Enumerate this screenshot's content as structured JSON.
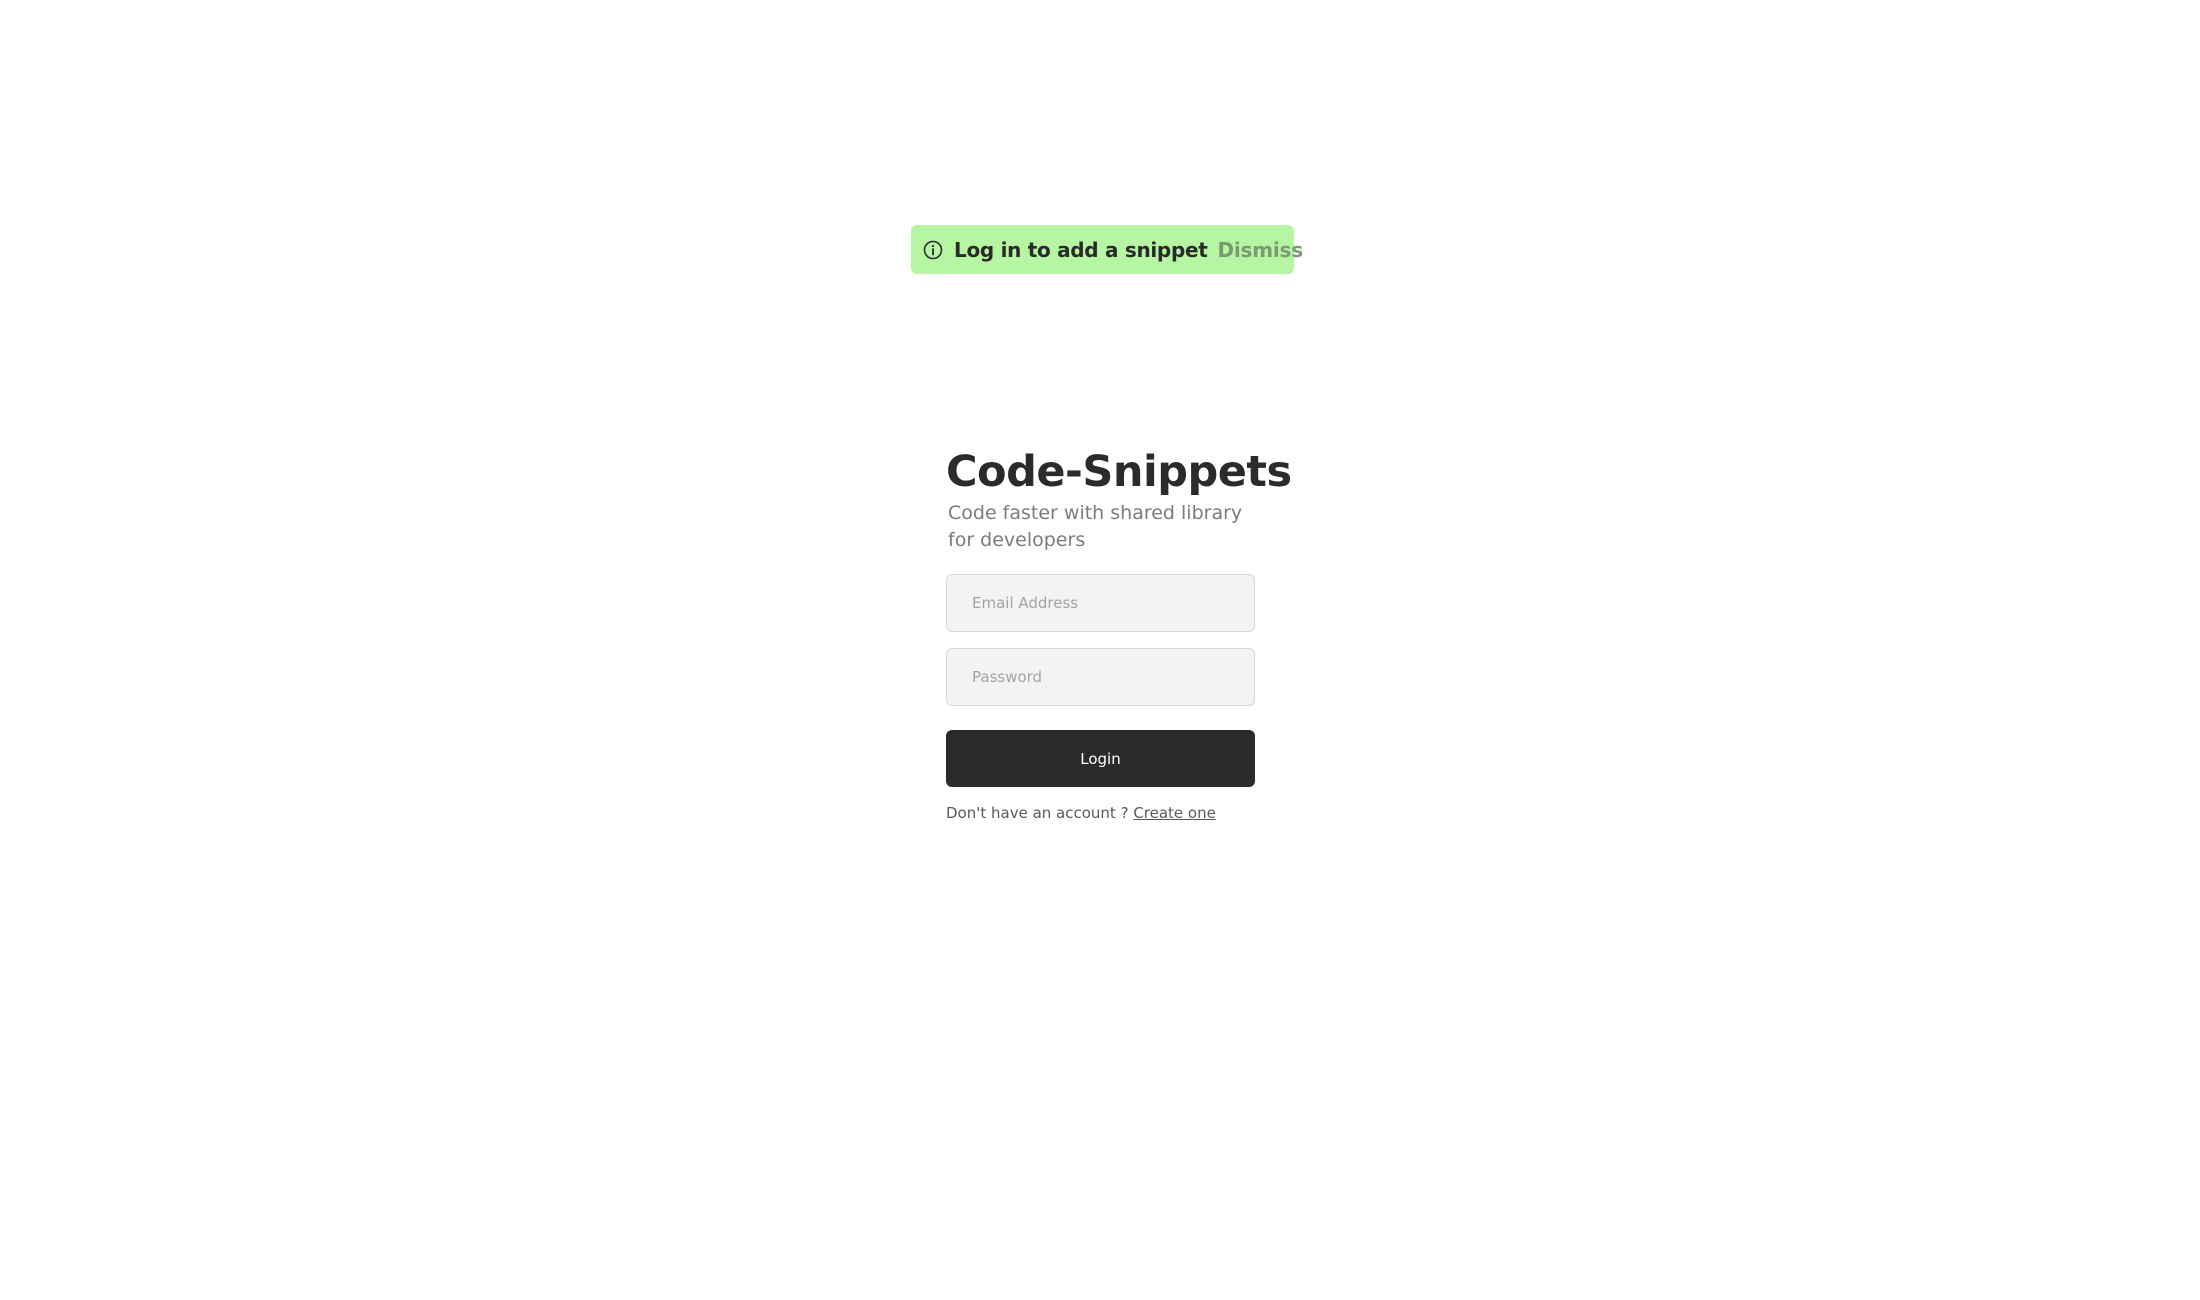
{
  "toast": {
    "icon": "info-icon",
    "message": "Log  in to add a snippet",
    "dismiss_label": "Dismiss",
    "background_color": "#b6f5a1"
  },
  "login": {
    "title": "Code-Snippets",
    "subtitle": "Code faster with shared library for developers",
    "email_placeholder": "Email Address",
    "email_value": "",
    "password_placeholder": "Password",
    "password_value": "",
    "login_label": "Login",
    "signup_prompt": "Don't have an account ? ",
    "signup_link": "Create one",
    "button_color": "#2b2b2b"
  }
}
